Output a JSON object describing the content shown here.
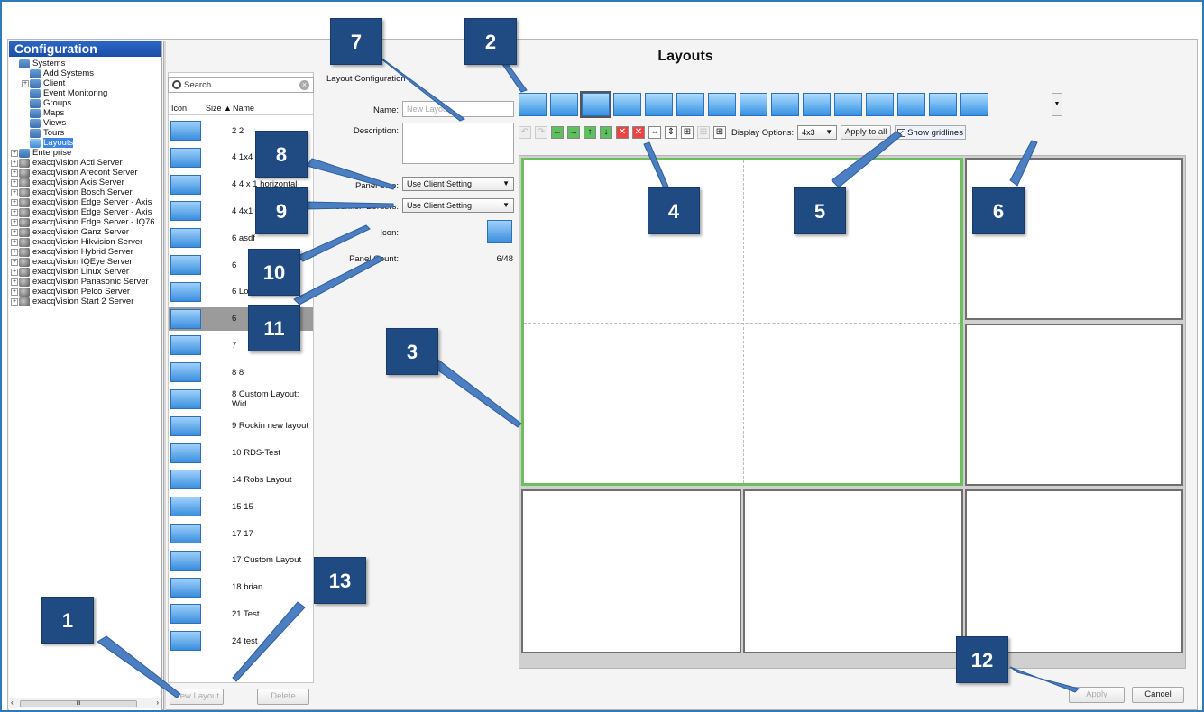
{
  "sidebar": {
    "title": "Configuration",
    "items": [
      {
        "label": "Systems",
        "icon": "systems-icon",
        "level": 0,
        "exp": ""
      },
      {
        "label": "Add Systems",
        "icon": "add-systems-icon",
        "level": 1,
        "exp": ""
      },
      {
        "label": "Client",
        "icon": "client-icon",
        "level": 1,
        "exp": "+"
      },
      {
        "label": "Event Monitoring",
        "icon": "event-monitoring-icon",
        "level": 1,
        "exp": ""
      },
      {
        "label": "Groups",
        "icon": "groups-icon",
        "level": 1,
        "exp": ""
      },
      {
        "label": "Maps",
        "icon": "maps-icon",
        "level": 1,
        "exp": ""
      },
      {
        "label": "Views",
        "icon": "views-icon",
        "level": 1,
        "exp": ""
      },
      {
        "label": "Tours",
        "icon": "tours-icon",
        "level": 1,
        "exp": ""
      },
      {
        "label": "Layouts",
        "icon": "layouts-icon",
        "level": 1,
        "exp": "",
        "selected": true
      },
      {
        "label": "Enterprise",
        "icon": "enterprise-icon",
        "level": 0,
        "exp": "+"
      },
      {
        "label": "exacqVision Acti Server",
        "icon": "server-icon",
        "level": 0,
        "exp": "+"
      },
      {
        "label": "exacqVision Arecont Server",
        "icon": "server-icon",
        "level": 0,
        "exp": "+"
      },
      {
        "label": "exacqVision Axis Server",
        "icon": "server-icon",
        "level": 0,
        "exp": "+"
      },
      {
        "label": "exacqVision Bosch Server",
        "icon": "server-icon",
        "level": 0,
        "exp": "+"
      },
      {
        "label": "exacqVision Edge Server - Axis",
        "icon": "server-icon",
        "level": 0,
        "exp": "+"
      },
      {
        "label": "exacqVision Edge Server - Axis",
        "icon": "server-icon",
        "level": 0,
        "exp": "+"
      },
      {
        "label": "exacqVision Edge Server - IQ76",
        "icon": "server-icon",
        "level": 0,
        "exp": "+"
      },
      {
        "label": "exacqVision Ganz Server",
        "icon": "server-icon",
        "level": 0,
        "exp": "+"
      },
      {
        "label": "exacqVision Hikvision Server",
        "icon": "server-icon",
        "level": 0,
        "exp": "+"
      },
      {
        "label": "exacqVision Hybrid Server",
        "icon": "server-icon",
        "level": 0,
        "exp": "+"
      },
      {
        "label": "exacqVision IQEye Server",
        "icon": "server-icon",
        "level": 0,
        "exp": "+"
      },
      {
        "label": "exacqVision Linux Server",
        "icon": "server-icon",
        "level": 0,
        "exp": "+"
      },
      {
        "label": "exacqVision Panasonic Server",
        "icon": "server-icon",
        "level": 0,
        "exp": "+"
      },
      {
        "label": "exacqVision Pelco Server",
        "icon": "server-icon",
        "level": 0,
        "exp": "+"
      },
      {
        "label": "exacqVision Start 2 Server",
        "icon": "server-icon",
        "level": 0,
        "exp": "+"
      }
    ],
    "scroll_thumb": "III"
  },
  "layout_list": {
    "search_placeholder": "Search",
    "headers": {
      "icon": "Icon",
      "size": "Size",
      "name": "Name"
    },
    "rows": [
      {
        "label": "2 2"
      },
      {
        "label": "4 1x4"
      },
      {
        "label": "4 4 x 1 horizontal"
      },
      {
        "label": "4 4x1"
      },
      {
        "label": "6 asdf"
      },
      {
        "label": "6"
      },
      {
        "label": "6 Long"
      },
      {
        "label": "6",
        "selected": true
      },
      {
        "label": "7"
      },
      {
        "label": "8 8"
      },
      {
        "label": "8 Custom Layout: Wid"
      },
      {
        "label": "9 Rockin new layout"
      },
      {
        "label": "10 RDS-Test"
      },
      {
        "label": "14 Robs Layout"
      },
      {
        "label": "15 15"
      },
      {
        "label": "17 17"
      },
      {
        "label": "17 Custom Layout"
      },
      {
        "label": "18 brian"
      },
      {
        "label": "21 Test"
      },
      {
        "label": "24 test"
      }
    ],
    "new_button": "New Layout",
    "delete_button": "Delete"
  },
  "config": {
    "section_title": "Layout Configuration",
    "name_label": "Name:",
    "name_placeholder": "New Layout",
    "description_label": "Description:",
    "panel_size_label": "Panel Size:",
    "panel_size_value": "Use Client Setting",
    "sunken_label": "Sunken Borders:",
    "sunken_value": "Use Client Setting",
    "icon_label": "Icon:",
    "panel_count_label": "Panel Count:",
    "panel_count_value": "6/48"
  },
  "main": {
    "title": "Layouts",
    "display_options_label": "Display Options:",
    "display_options_value": "4x3",
    "apply_all_button": "Apply to all",
    "show_gridlines_label": "Show gridlines",
    "show_gridlines_checked": true,
    "apply_button": "Apply",
    "cancel_button": "Cancel"
  },
  "callouts": [
    "1",
    "2",
    "3",
    "4",
    "5",
    "6",
    "7",
    "8",
    "9",
    "10",
    "11",
    "12",
    "13"
  ]
}
